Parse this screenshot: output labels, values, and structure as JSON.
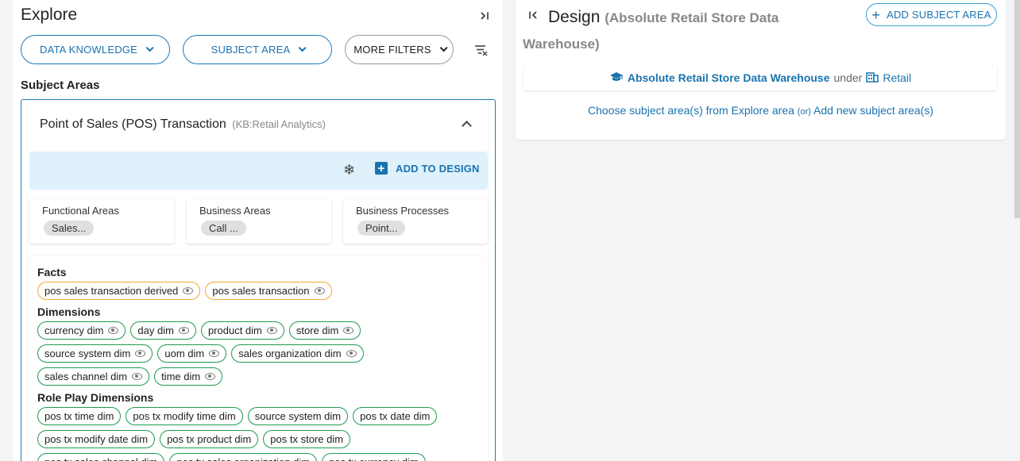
{
  "explore": {
    "title": "Explore",
    "filters": {
      "data_knowledge": "DATA KNOWLEDGE",
      "subject_area": "SUBJECT AREA",
      "more_filters": "MORE FILTERS"
    },
    "subject_areas_label": "Subject Areas",
    "card": {
      "title": "Point of Sales (POS) Transaction",
      "kb": "(KB:Retail Analytics)",
      "add_to_design": "ADD TO DESIGN",
      "areas": [
        {
          "label": "Functional Areas",
          "chip": "Sales..."
        },
        {
          "label": "Business Areas",
          "chip": "Call ..."
        },
        {
          "label": "Business Processes",
          "chip": "Point..."
        }
      ],
      "facts_title": "Facts",
      "facts": [
        "pos sales transaction derived",
        "pos sales transaction"
      ],
      "dimensions_title": "Dimensions",
      "dimensions": [
        [
          "currency dim",
          "day dim",
          "product dim",
          "store dim"
        ],
        [
          "source system dim",
          "uom dim",
          "sales organization dim"
        ],
        [
          "sales channel dim",
          "time dim"
        ]
      ],
      "role_play_title": "Role Play Dimensions",
      "role_play": [
        [
          "pos tx time dim",
          "pos tx modify time dim",
          "source system dim",
          "pos tx date dim"
        ],
        [
          "pos tx modify date dim",
          "pos tx product dim",
          "pos tx store dim"
        ],
        [
          "pos tx sales channel dim",
          "pos tx sales organization dim",
          "pos tx currency dim"
        ]
      ]
    }
  },
  "design": {
    "title": "Design",
    "subtitle": "(Absolute Retail Store Data Warehouse)",
    "add_subject_area": "ADD SUBJECT AREA",
    "warehouse_name": "Absolute Retail Store Data Warehouse",
    "under": "under",
    "domain": "Retail",
    "choose_text": "Choose subject area(s) from Explore area",
    "or_text": "(or)",
    "add_new_text": "Add new subject area(s)"
  },
  "colors": {
    "accent": "#1a73b0",
    "fact_border": "#f0a830",
    "dim_border": "#1e9a4f",
    "action_bar": "#dff1fb"
  }
}
